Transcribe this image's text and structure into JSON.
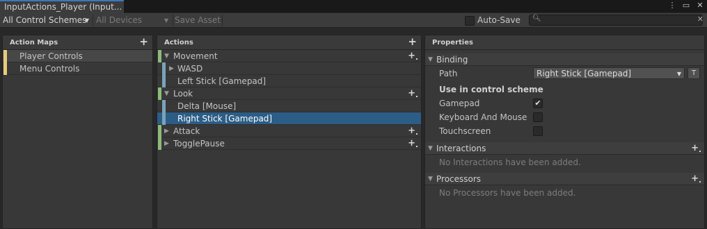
{
  "window": {
    "tab_title": "InputActions_Player (Input...",
    "icons": [
      "kebab-menu-icon",
      "maximize-icon",
      "close-icon"
    ]
  },
  "toolbar": {
    "control_schemes": "All Control Schemes",
    "devices": "All Devices",
    "save_asset": "Save Asset",
    "auto_save": "Auto-Save",
    "auto_save_checked": false,
    "search_value": "",
    "search_placeholder": ""
  },
  "action_maps": {
    "header": "Action Maps",
    "items": [
      {
        "label": "Player Controls",
        "selected": true
      },
      {
        "label": "Menu Controls",
        "selected": false
      }
    ]
  },
  "actions": {
    "header": "Actions",
    "rows": [
      {
        "label": "Movement",
        "kind": "action",
        "expanded": true
      },
      {
        "label": "WASD",
        "kind": "composite",
        "expanded": false
      },
      {
        "label": "Left Stick [Gamepad]",
        "kind": "binding"
      },
      {
        "label": "Look",
        "kind": "action",
        "expanded": true
      },
      {
        "label": "Delta [Mouse]",
        "kind": "binding"
      },
      {
        "label": "Right Stick [Gamepad]",
        "kind": "binding",
        "selected": true
      },
      {
        "label": "Attack",
        "kind": "action",
        "expanded": false
      },
      {
        "label": "TogglePause",
        "kind": "action",
        "expanded": false
      }
    ]
  },
  "properties": {
    "header": "Properties",
    "binding_section": "Binding",
    "path_label": "Path",
    "path_value": "Right Stick [Gamepad]",
    "t_button": "T",
    "scheme_heading": "Use in control scheme",
    "schemes": [
      {
        "label": "Gamepad",
        "checked": true
      },
      {
        "label": "Keyboard And Mouse",
        "checked": false
      },
      {
        "label": "Touchscreen",
        "checked": false
      }
    ],
    "interactions_section": "Interactions",
    "interactions_empty": "No Interactions have been added.",
    "processors_section": "Processors",
    "processors_empty": "No Processors have been added."
  },
  "colors": {
    "accent_tab": "#3a79bb",
    "selection_blue": "#2c5d87",
    "map_bar": "#e8cb7a",
    "action_bar": "#8dba7a",
    "binding_bar": "#7aa3b8"
  }
}
